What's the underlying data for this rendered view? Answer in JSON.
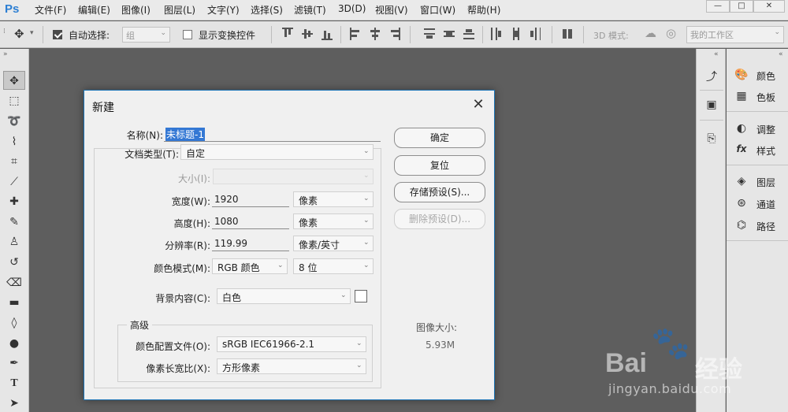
{
  "app": {
    "logo": "Ps"
  },
  "menu": [
    {
      "id": "file",
      "label": "文件(F)"
    },
    {
      "id": "edit",
      "label": "编辑(E)"
    },
    {
      "id": "image",
      "label": "图像(I)"
    },
    {
      "id": "layer",
      "label": "图层(L)"
    },
    {
      "id": "type",
      "label": "文字(Y)"
    },
    {
      "id": "select",
      "label": "选择(S)"
    },
    {
      "id": "filter",
      "label": "滤镜(T)"
    },
    {
      "id": "3d",
      "label": "3D(D)"
    },
    {
      "id": "view",
      "label": "视图(V)"
    },
    {
      "id": "window",
      "label": "窗口(W)"
    },
    {
      "id": "help",
      "label": "帮助(H)"
    }
  ],
  "window_controls": {
    "minimize": "—",
    "maximize": "□",
    "close": "✕"
  },
  "options": {
    "auto_select_label": "自动选择:",
    "auto_select_checked": true,
    "auto_select_value": "组",
    "show_transform_label": "显示变换控件",
    "show_transform_checked": false,
    "mode_3d_label": "3D 模式:",
    "workspace": "我的工作区"
  },
  "tools": [
    {
      "name": "move-tool-icon",
      "glyph": "✥"
    },
    {
      "name": "marquee-tool-icon",
      "glyph": "⬚"
    },
    {
      "name": "lasso-tool-icon",
      "glyph": "➰"
    },
    {
      "name": "quick-select-tool-icon",
      "glyph": "⌇"
    },
    {
      "name": "crop-tool-icon",
      "glyph": "⌗"
    },
    {
      "name": "eyedropper-tool-icon",
      "glyph": "⟋"
    },
    {
      "name": "healing-tool-icon",
      "glyph": "✚"
    },
    {
      "name": "brush-tool-icon",
      "glyph": "✎"
    },
    {
      "name": "stamp-tool-icon",
      "glyph": "♙"
    },
    {
      "name": "history-brush-tool-icon",
      "glyph": "↺"
    },
    {
      "name": "eraser-tool-icon",
      "glyph": "⌫"
    },
    {
      "name": "gradient-tool-icon",
      "glyph": "▬"
    },
    {
      "name": "blur-tool-icon",
      "glyph": "◊"
    },
    {
      "name": "dodge-tool-icon",
      "glyph": "●"
    },
    {
      "name": "pen-tool-icon",
      "glyph": "✒"
    },
    {
      "name": "type-tool-icon",
      "glyph": "T"
    },
    {
      "name": "path-select-tool-icon",
      "glyph": "➤"
    }
  ],
  "panels": [
    {
      "name": "color",
      "label": "颜色",
      "glyph": "🎨"
    },
    {
      "name": "swatches",
      "label": "色板",
      "glyph": "▦"
    },
    {
      "name": "adjustments",
      "label": "调整",
      "glyph": "◐"
    },
    {
      "name": "styles",
      "label": "样式",
      "glyph": "fx"
    },
    {
      "name": "layers",
      "label": "图层",
      "glyph": "◈"
    },
    {
      "name": "channels",
      "label": "通道",
      "glyph": "⊛"
    },
    {
      "name": "paths",
      "label": "路径",
      "glyph": "⌬"
    }
  ],
  "dialog": {
    "title": "新建",
    "close": "✕",
    "name_label": "名称(N):",
    "name_value": "未标题-1",
    "doc_type_label": "文档类型(T):",
    "doc_type_value": "自定",
    "size_label": "大小(I):",
    "size_value": "",
    "width_label": "宽度(W):",
    "width_value": "1920",
    "width_unit": "像素",
    "height_label": "高度(H):",
    "height_value": "1080",
    "height_unit": "像素",
    "resolution_label": "分辨率(R):",
    "resolution_value": "119.99",
    "resolution_unit": "像素/英寸",
    "color_mode_label": "颜色模式(M):",
    "color_mode_value": "RGB 颜色",
    "bit_depth_value": "8 位",
    "background_label": "背景内容(C):",
    "background_value": "白色",
    "advanced_label": "高级",
    "color_profile_label": "颜色配置文件(O):",
    "color_profile_value": "sRGB IEC61966-2.1",
    "pixel_aspect_label": "像素长宽比(X):",
    "pixel_aspect_value": "方形像素",
    "ok_button": "确定",
    "reset_button": "复位",
    "save_preset_button": "存储预设(S)...",
    "delete_preset_button": "删除预设(D)...",
    "image_size_label": "图像大小:",
    "image_size_value": "5.93M"
  },
  "watermark": {
    "bai": "Bai",
    "paw": "🐾",
    "jingyan": "经验",
    "url": "jingyan.baidu.com"
  }
}
